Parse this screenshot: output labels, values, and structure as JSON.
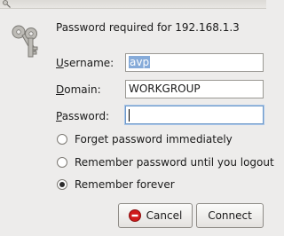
{
  "dialog": {
    "header": "Password required for 192.168.1.3",
    "username": {
      "label": "Username:",
      "access_key": "U",
      "value": "avp"
    },
    "domain": {
      "label": "Domain:",
      "access_key": "D",
      "value": "WORKGROUP"
    },
    "password": {
      "label": "Password:",
      "access_key": "P",
      "value": ""
    },
    "options": [
      {
        "label": "Forget password immediately",
        "checked": false
      },
      {
        "label": "Remember password until you logout",
        "checked": false
      },
      {
        "label": "Remember forever",
        "checked": true
      }
    ],
    "buttons": {
      "cancel": "Cancel",
      "connect": "Connect"
    }
  },
  "icons": {
    "titlebar": "keys-icon",
    "auth": "keys-icon",
    "cancel": "stop-icon"
  },
  "colors": {
    "selection": "#86abd9",
    "focus_border": "#6f99c9",
    "cancel_icon": "#d01a1a"
  }
}
